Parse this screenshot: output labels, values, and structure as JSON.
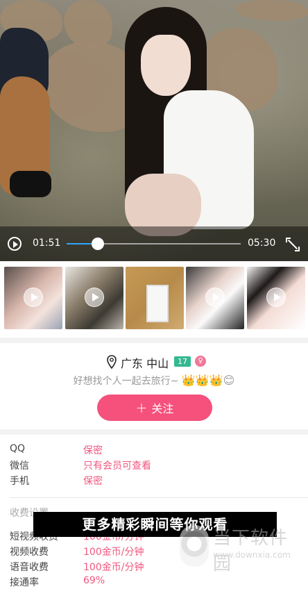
{
  "player": {
    "current_time": "01:51",
    "total_time": "05:30",
    "progress": 0.18,
    "accent_color": "#2fa6ff"
  },
  "thumbnails": [
    {
      "has_play": true
    },
    {
      "has_play": true
    },
    {
      "has_play": false
    },
    {
      "has_play": true
    },
    {
      "has_play": true
    }
  ],
  "profile": {
    "location": "广东 中山",
    "age": "17",
    "gender_icon": "female-icon",
    "bio": "好想找个人一起去旅行~",
    "bio_emojis": "👑👑👑😊",
    "follow_plus": "+",
    "follow_label": "关注",
    "accent_color": "#f5517c"
  },
  "contact": [
    {
      "label": "QQ",
      "value": "保密"
    },
    {
      "label": "微信",
      "value": "只有会员可查看"
    },
    {
      "label": "手机",
      "value": "保密"
    }
  ],
  "fees": {
    "section_title": "收费设置",
    "items": [
      {
        "label": "短视频收费",
        "value": "100金币/分钟"
      },
      {
        "label": "视频收费",
        "value": "100金币/分钟"
      },
      {
        "label": "语音收费",
        "value": "100金币/分钟"
      },
      {
        "label": "接通率",
        "value": "69%"
      }
    ]
  },
  "banner": {
    "text": "更多精彩瞬间等你观看"
  },
  "watermark": {
    "name": "当下软件园",
    "url": "www.downxia.com"
  }
}
